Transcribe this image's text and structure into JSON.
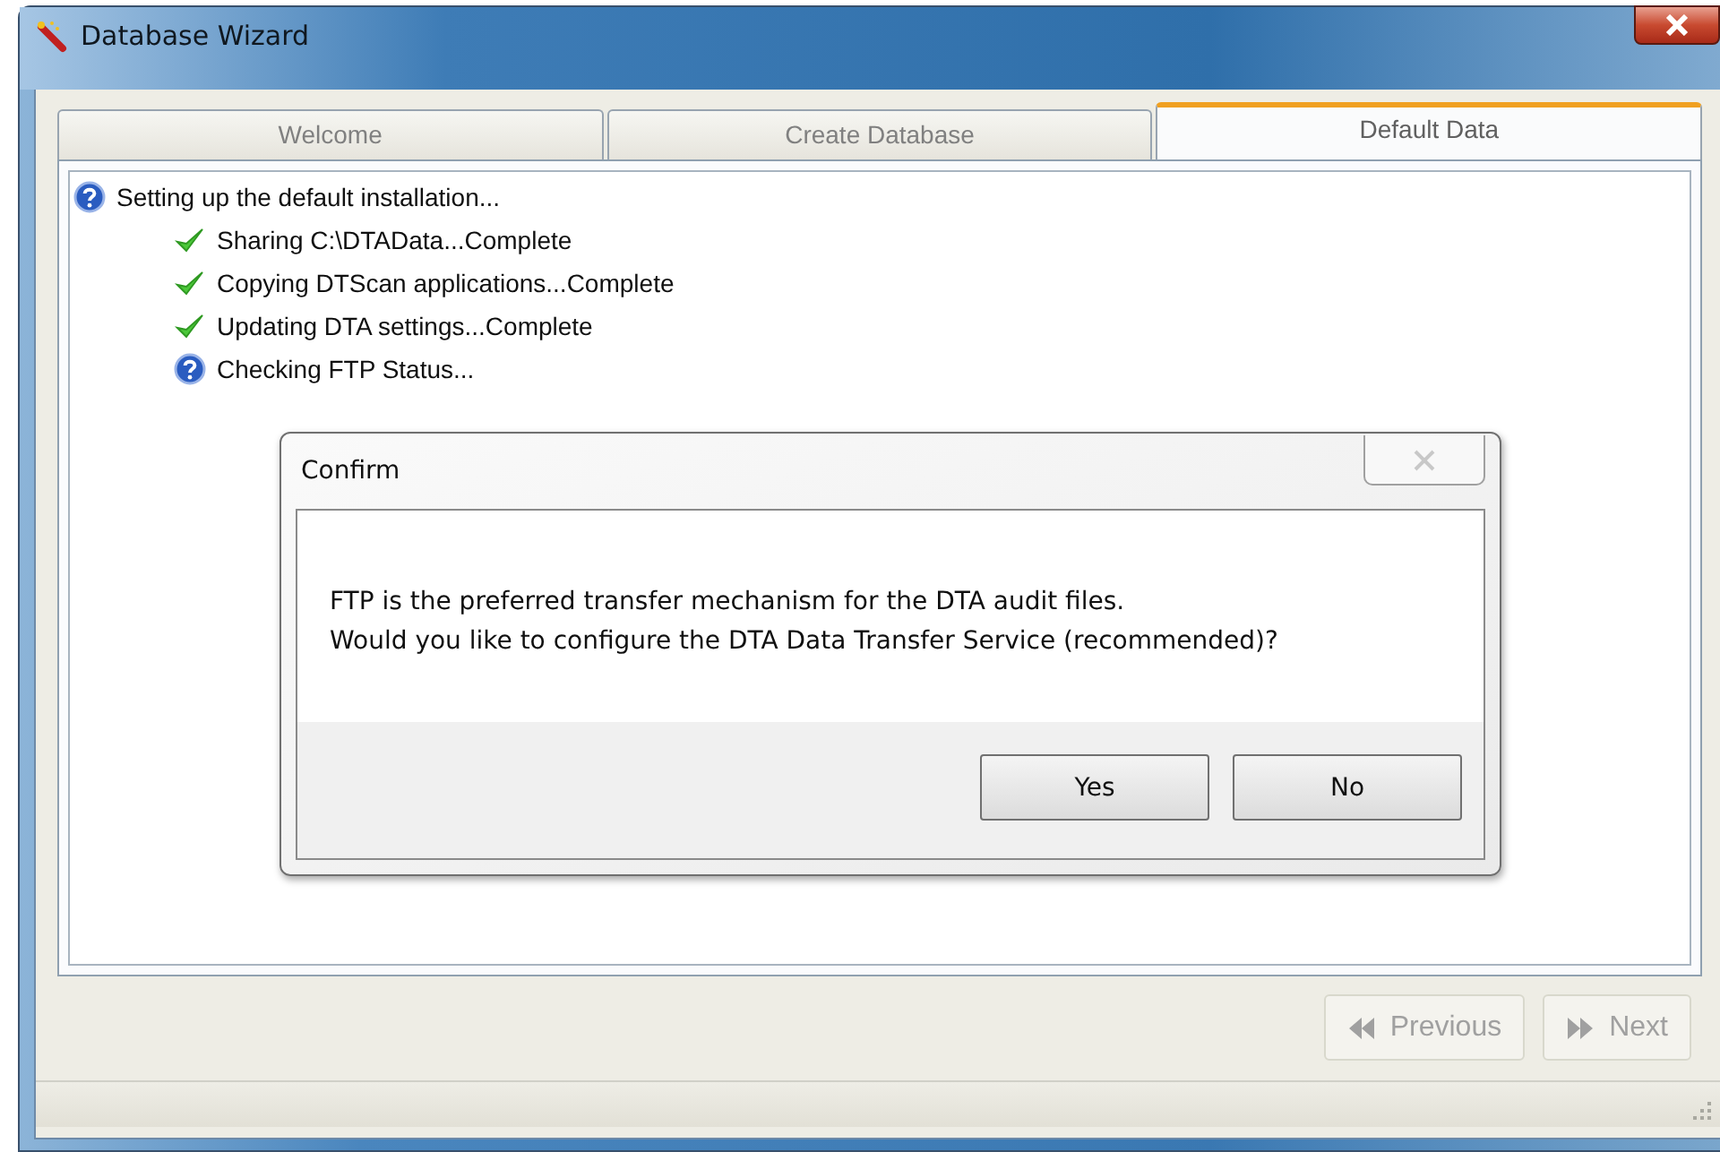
{
  "window": {
    "title": "Database Wizard"
  },
  "tabs": [
    {
      "label": "Welcome",
      "selected": false
    },
    {
      "label": "Create Database",
      "selected": false
    },
    {
      "label": "Default Data",
      "selected": true
    }
  ],
  "log": [
    {
      "kind": "pending",
      "text": "Setting up the default installation...",
      "children": [
        {
          "kind": "done",
          "text": "Sharing C:\\DTAData...Complete"
        },
        {
          "kind": "done",
          "text": "Copying DTScan applications...Complete"
        },
        {
          "kind": "done",
          "text": "Updating DTA settings...Complete"
        },
        {
          "kind": "pending",
          "text": "Checking FTP Status..."
        }
      ]
    }
  ],
  "nav_buttons": [
    {
      "kind": "back",
      "label": "Previous",
      "disabled": true
    },
    {
      "kind": "forward",
      "label": "Next",
      "disabled": true
    }
  ],
  "dialog": {
    "title": "Confirm",
    "message": [
      "FTP is the preferred transfer mechanism for the DTA audit files.",
      "Would you like to configure the DTA Data Transfer Service (recommended)?"
    ],
    "buttons": [
      "Yes",
      "No"
    ]
  }
}
